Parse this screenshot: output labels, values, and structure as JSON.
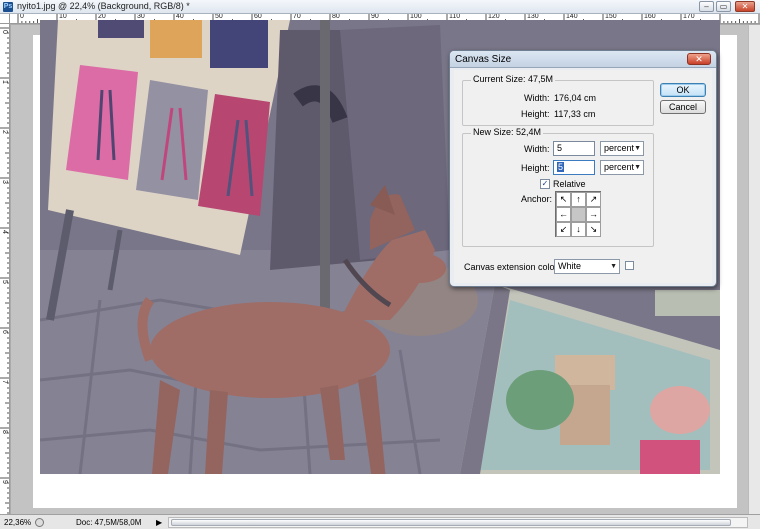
{
  "window": {
    "title": "nyito1.jpg @ 22,4% (Background, RGB/8) *",
    "app_icon": "Ps",
    "minimize": "–",
    "restore": "▭",
    "close": "✕"
  },
  "ruler": {
    "top_labels": [
      "0",
      "10",
      "20",
      "30",
      "40",
      "50",
      "60",
      "70",
      "80",
      "90",
      "100",
      "110",
      "120",
      "130",
      "140",
      "150",
      "160",
      "170"
    ],
    "left_labels": [
      "0",
      "1",
      "2",
      "3",
      "4",
      "5",
      "6",
      "7",
      "8",
      "9"
    ]
  },
  "status": {
    "zoom": "22,36%",
    "doc": "Doc: 47,5M/58,0M",
    "arrow": "▶"
  },
  "dialog": {
    "title": "Canvas Size",
    "close": "✕",
    "current_size": {
      "legend": "Current Size: 47,5M",
      "width_label": "Width:",
      "width_value": "176,04 cm",
      "height_label": "Height:",
      "height_value": "117,33 cm"
    },
    "new_size": {
      "legend": "New Size: 52,4M",
      "width_label": "Width:",
      "width_value": "5",
      "width_unit": "percent",
      "height_label": "Height:",
      "height_value": "5",
      "height_unit": "percent",
      "relative_label": "Relative",
      "relative_checked": "✓",
      "anchor_label": "Anchor:",
      "anchor_arrows": [
        "↖",
        "↑",
        "↗",
        "←",
        "",
        "→",
        "↙",
        "↓",
        "↘"
      ]
    },
    "extension": {
      "label": "Canvas extension color:",
      "value": "White"
    },
    "ok": "OK",
    "cancel": "Cancel"
  },
  "colors": {
    "accent": "#3166b8",
    "close_red": "#c8402a",
    "dialog_bg": "#f0f0f0"
  }
}
